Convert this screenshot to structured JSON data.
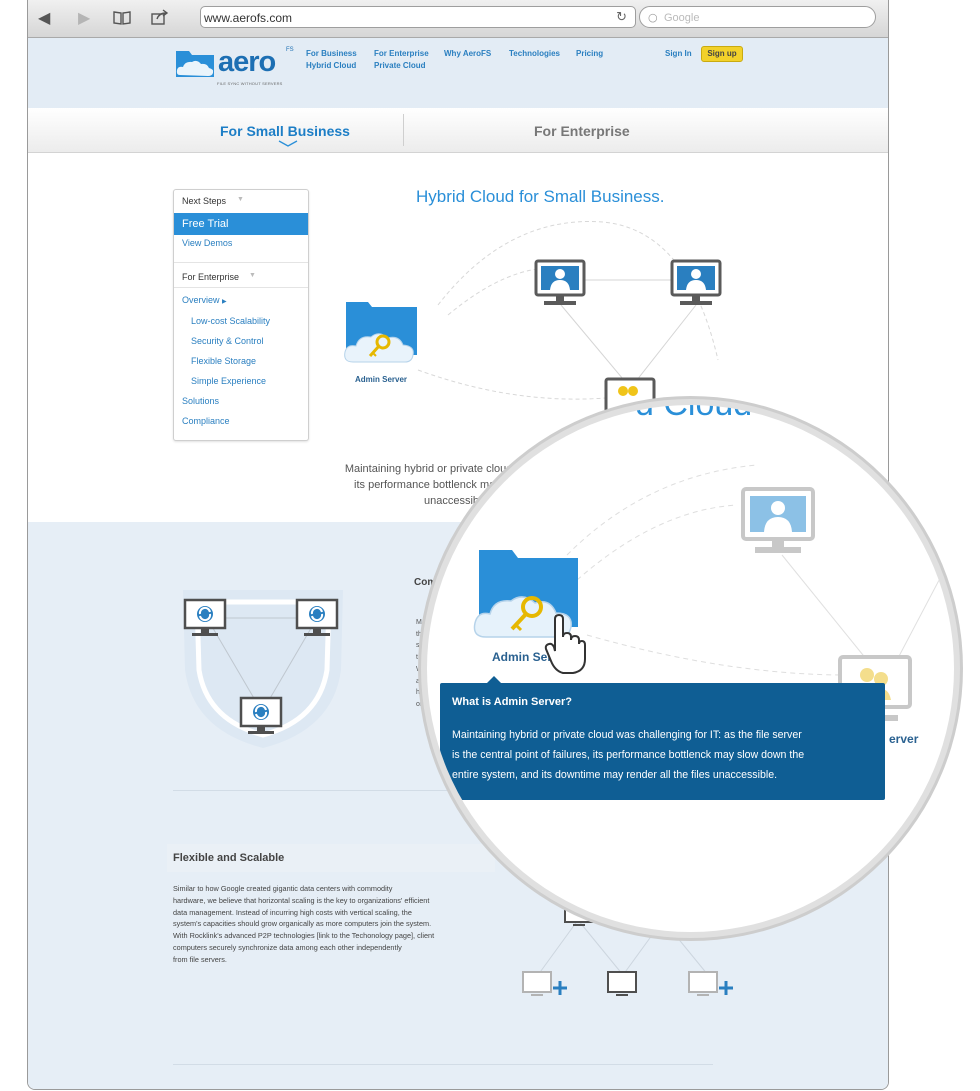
{
  "browser": {
    "url": "www.aerofs.com",
    "search_placeholder": "Google",
    "icons": [
      "back-icon",
      "forward-icon",
      "bookmarks-icon",
      "share-icon",
      "reload-icon",
      "search-icon"
    ]
  },
  "header": {
    "logo_text": "aero",
    "logo_superscript": "FS",
    "logo_tagline": "FILE SYNC WITHOUT SERVERS",
    "nav": [
      {
        "label": "For Business"
      },
      {
        "label": "For Enterprise"
      },
      {
        "label": "Why AeroFS"
      },
      {
        "label": "Technologies"
      },
      {
        "label": "Pricing"
      }
    ],
    "subnav": [
      {
        "label": "Hybrid Cloud"
      },
      {
        "label": "Private Cloud"
      }
    ],
    "sign_in": "Sign In",
    "sign_up": "Sign up"
  },
  "tabs": [
    {
      "label": "For Small Business",
      "active": true
    },
    {
      "label": "For Enterprise",
      "active": false
    }
  ],
  "sidebar": {
    "next_steps_heading": "Next Steps",
    "free_trial": "Free Trial",
    "view_demos": "View Demos",
    "enterprise_heading": "For Enterprise",
    "overview": "Overview",
    "items": [
      {
        "label": "Low-cost Scalability"
      },
      {
        "label": "Security & Control"
      },
      {
        "label": "Flexible Storage"
      },
      {
        "label": "Simple Experience"
      }
    ],
    "solutions": "Solutions",
    "compliance": "Compliance"
  },
  "main": {
    "headline": "Hybrid Cloud for Small Business.",
    "admin_server_label": "Admin Server",
    "intro_lines": [
      "Maintaining hybrid or private cloud was challenging for IT: as th",
      "its performance bottlenck may slow down the entire system",
      "unaccessible. Especially with t"
    ],
    "section2_title_cut": "Com",
    "section2_lines_cut": [
      "Mai",
      "the",
      "syst",
      "trer",
      "With",
      "adap",
      "hard",
      "organ"
    ],
    "flexible_title": "Flexible and Scalable",
    "flexible_lines": [
      "Similar to how Google created gigantic data centers with commodity",
      "hardware, we believe that horizontal scaling is the key to organizations' efficient",
      "data management. Instead of incurring high costs with vertical scaling, the",
      "system's capacities should grow organically as more computers join the system.",
      "With Rocklink's advanced P2P technologies [link to the Techonology page], client",
      "computers securely synchronize data among each other independently",
      "from file servers."
    ]
  },
  "magnifier": {
    "title_fragment": "d Cloud",
    "admin_label": "Admin Ser",
    "server_label": "erver",
    "tooltip_title": "What is Admin Server?",
    "tooltip_lines": [
      "Maintaining hybrid or private cloud was challenging for IT: as the file server",
      "is the central point of failures, its performance bottlenck may slow down the",
      "entire system, and its downtime may render all the files unaccessible."
    ]
  },
  "colors": {
    "brand_blue": "#2a8fd8",
    "nav_blue": "#2a7fc0",
    "tooltip_bg": "#0f5e94",
    "signup_yellow": "#f2d12a",
    "header_bg": "#e3ecf5",
    "section_bg": "#e6eef6",
    "monitor_blue": "#2a7fc0",
    "key_yellow": "#f0c419"
  }
}
